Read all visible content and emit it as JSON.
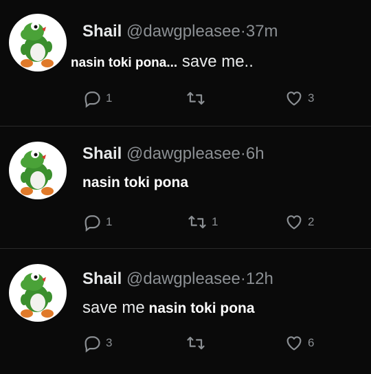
{
  "tweets": [
    {
      "name": "Shail",
      "handle": "@dawgpleasee",
      "separator": "·",
      "time": "37m",
      "text_parts": [
        "nasin toki pona...",
        " save me.."
      ],
      "replies": "1",
      "retweets": "",
      "likes": "3"
    },
    {
      "name": "Shail",
      "handle": "@dawgpleasee",
      "separator": "·",
      "time": "6h",
      "text_parts": [
        "nasin toki pona"
      ],
      "replies": "1",
      "retweets": "1",
      "likes": "2"
    },
    {
      "name": "Shail",
      "handle": "@dawgpleasee",
      "separator": "·",
      "time": "12h",
      "text_parts": [
        "save me",
        " nasin toki pona"
      ],
      "replies": "3",
      "retweets": "",
      "likes": "6"
    }
  ],
  "icons": {
    "reply": "reply-icon",
    "retweet": "retweet-icon",
    "like": "heart-icon",
    "avatar": "yoshi-avatar"
  },
  "colors": {
    "background": "#0a0a0a",
    "text": "#e7e9ea",
    "muted": "#8b8f93"
  }
}
